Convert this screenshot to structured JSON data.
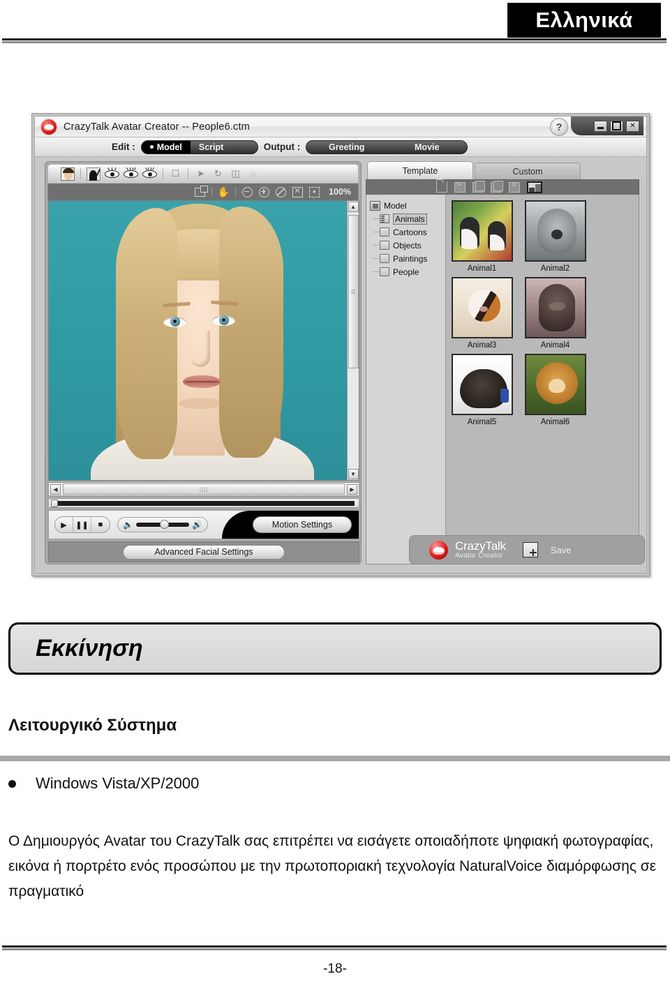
{
  "header": {
    "language_badge": "Ελληνικά"
  },
  "app": {
    "title": "CrazyTalk Avatar Creator -- People6.ctm",
    "logo_icon": "crazytalk-lips-logo",
    "help_button": "?",
    "window_controls": {
      "minimize": "minimize-icon",
      "maximize": "maximize-icon",
      "close": "✕"
    },
    "modebar": {
      "edit_label": "Edit :",
      "edit_tabs": [
        {
          "label": "Model",
          "selected": true
        },
        {
          "label": "Script",
          "selected": false
        }
      ],
      "output_label": "Output :",
      "output_tabs": [
        {
          "label": "Greeting",
          "selected": false
        },
        {
          "label": "Movie",
          "selected": false
        }
      ]
    },
    "left_toolbar": {
      "icons": [
        "face-thumbnail-icon",
        "silhouette-edit-icon",
        "eye-icon",
        "eye-lashes-icon",
        "eye-detail-icon",
        "frame-icon",
        "pointer-icon",
        "rotate-icon",
        "page-icon",
        "mouth-icon"
      ],
      "view_icons": [
        "expand-icon",
        "hand-pan-icon",
        "zoom-out-icon",
        "zoom-in-icon",
        "no-zoom-icon",
        "fit-screen-icon",
        "center-icon"
      ],
      "zoom_level": "100%"
    },
    "canvas": {
      "scroll_thumb_marker": "||||",
      "subject": "blonde-woman-portrait"
    },
    "playback": {
      "play": "▶",
      "pause": "❚❚",
      "stop": "■",
      "volume_icon_low": "◀|",
      "volume_icon_high": "◀))"
    },
    "motion_settings_button": "Motion Settings",
    "advanced_facial_settings_button": "Advanced Facial Settings",
    "right_panel": {
      "tabs": [
        {
          "label": "Template",
          "active": true
        },
        {
          "label": "Custom",
          "active": false
        }
      ],
      "toolbar_icons": [
        "open-folder-icon",
        "cut-icon",
        "copy-icon",
        "paste-icon",
        "delete-icon",
        "view-mode-icon"
      ],
      "tree": {
        "root": "Model",
        "items": [
          {
            "label": "Animals",
            "selected": true
          },
          {
            "label": "Cartoons",
            "selected": false
          },
          {
            "label": "Objects",
            "selected": false
          },
          {
            "label": "Paintings",
            "selected": false
          },
          {
            "label": "People",
            "selected": false
          }
        ]
      },
      "thumbnails": [
        {
          "caption": "Animal1",
          "art": "dalmatian-puppies"
        },
        {
          "caption": "Animal2",
          "art": "koala"
        },
        {
          "caption": "Animal3",
          "art": "calico-cat"
        },
        {
          "caption": "Animal4",
          "art": "gorilla"
        },
        {
          "caption": "Animal5",
          "art": "black-puppy"
        },
        {
          "caption": "Animal6",
          "art": "lion"
        }
      ]
    },
    "brand": {
      "line1": "CrazyTalk",
      "line2": "Avatar Creator",
      "save_label": "Save",
      "save_icon": "save-document-icon"
    }
  },
  "document": {
    "section_title": "Εκκίνηση",
    "sub_title": "Λειτουργικό Σύστημα",
    "bullet": "Windows Vista/XP/2000",
    "paragraph": "Ο Δημιουργός Avatar του CrazyTalk σας επιτρέπει να εισάγετε οποιαδήποτε ψηφιακή φωτογραφίας, εικόνα ή πορτρέτο ενός προσώπου με την πρωτοποριακή τεχνολογία NaturalVoice διαμόρφωσης σε πραγματικό",
    "page_number": "-18-"
  }
}
